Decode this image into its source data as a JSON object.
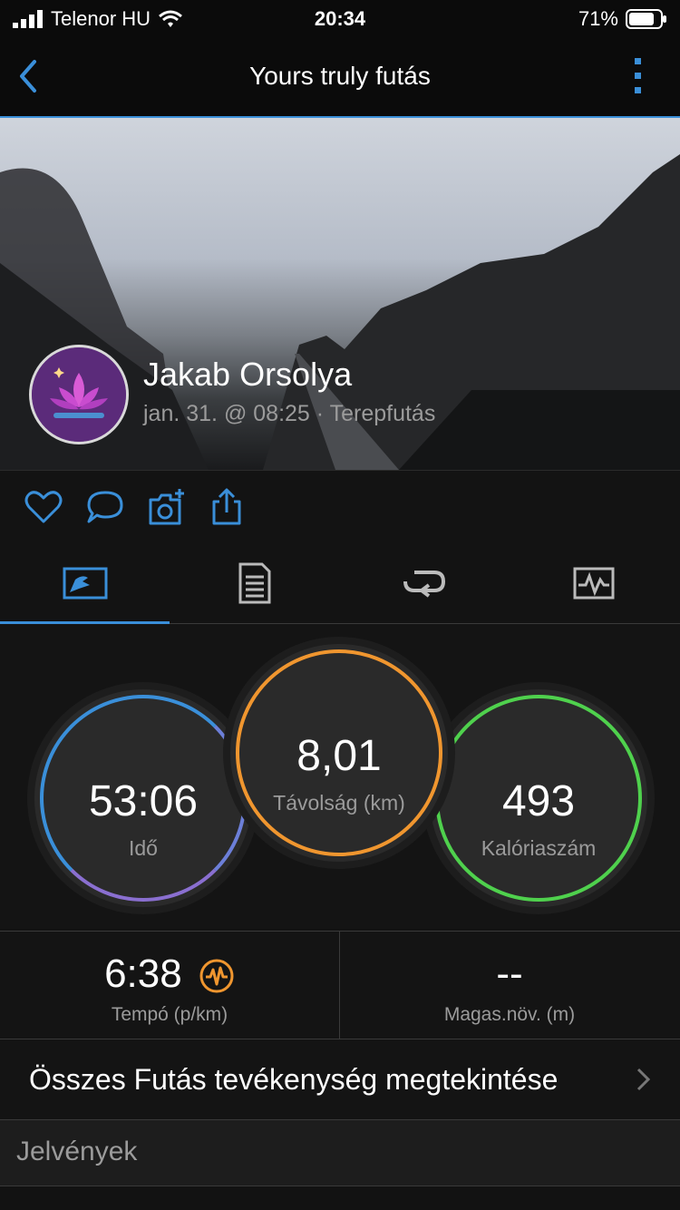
{
  "status_bar": {
    "carrier": "Telenor HU",
    "time": "20:34",
    "battery": "71%"
  },
  "nav": {
    "title": "Yours truly futás"
  },
  "activity": {
    "user_name": "Jakab Orsolya",
    "meta": "jan. 31. @ 08:25 · Terepfutás"
  },
  "stats": {
    "time": {
      "value": "53:06",
      "label": "Idő"
    },
    "distance": {
      "value": "8,01",
      "label": "Távolság (km)"
    },
    "calories": {
      "value": "493",
      "label": "Kalóriaszám"
    }
  },
  "metrics": {
    "pace": {
      "value": "6:38",
      "label": "Tempó (p/km)"
    },
    "elevation": {
      "value": "--",
      "label": "Magas.növ. (m)"
    }
  },
  "view_all": {
    "label": "Összes Futás tevékenység megtekintése"
  },
  "badges": {
    "title": "Jelvények"
  },
  "colors": {
    "accent": "#3a8fd9",
    "orange": "#f0962f",
    "green": "#4fd14d",
    "purple": "#8a6fd0"
  }
}
